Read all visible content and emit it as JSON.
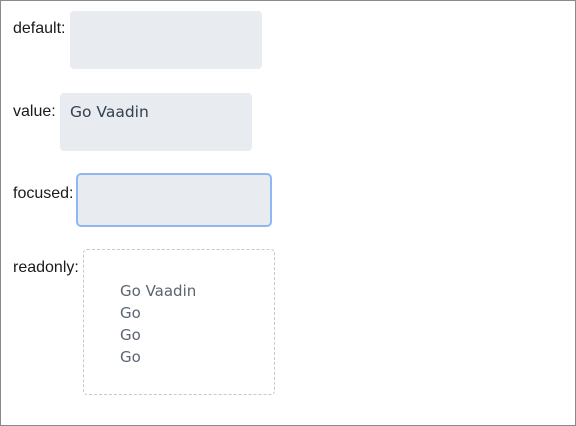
{
  "rows": {
    "default": {
      "label": "default:",
      "value": ""
    },
    "value": {
      "label": "value:",
      "value": "Go Vaadin"
    },
    "focused": {
      "label": "focused:",
      "value": ""
    },
    "readonly": {
      "label": "readonly:",
      "lines": [
        "Go Vaadin",
        "Go",
        "Go",
        "Go"
      ]
    }
  },
  "colors": {
    "field_background": "#e8ebef",
    "focus_ring": "#8fb8f2",
    "readonly_border": "#c5c9cf",
    "text": "#33404f"
  }
}
